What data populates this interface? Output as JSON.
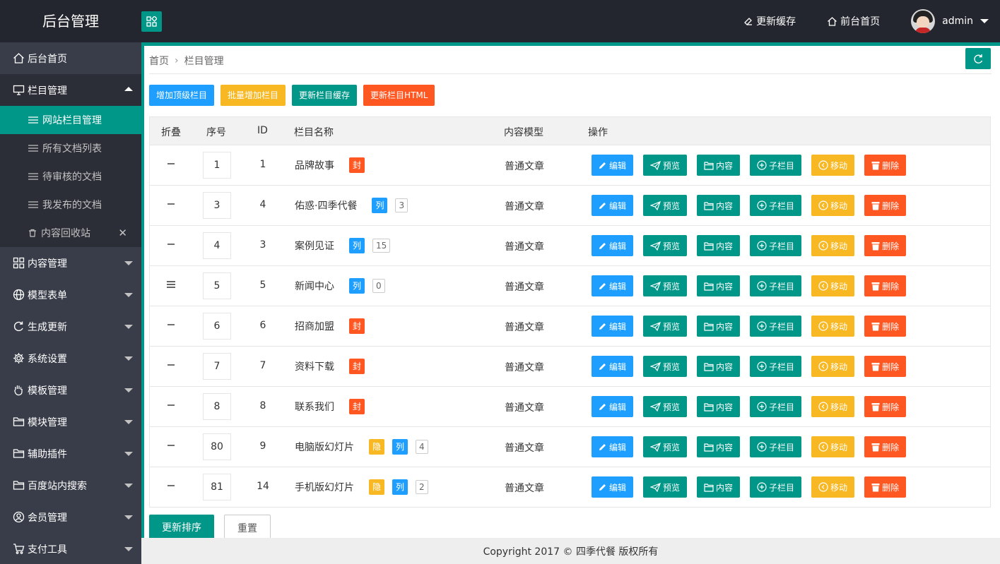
{
  "header": {
    "logo": "后台管理",
    "clear_cache": "更新缓存",
    "front_home": "前台首页",
    "user": "admin"
  },
  "sidebar": {
    "home": "后台首页",
    "column_mgmt": "栏目管理",
    "sub": [
      {
        "label": "网站栏目管理"
      },
      {
        "label": "所有文档列表"
      },
      {
        "label": "待审核的文档"
      },
      {
        "label": "我发布的文档"
      },
      {
        "label": "内容回收站"
      }
    ],
    "sections": [
      {
        "label": "内容管理",
        "icon": "apps-icon"
      },
      {
        "label": "模型表单",
        "icon": "globe-icon"
      },
      {
        "label": "生成更新",
        "icon": "refresh-icon"
      },
      {
        "label": "系统设置",
        "icon": "gear-icon"
      },
      {
        "label": "模板管理",
        "icon": "hand-icon"
      },
      {
        "label": "模块管理",
        "icon": "folder-icon"
      },
      {
        "label": "辅助插件",
        "icon": "folder-icon"
      },
      {
        "label": "百度站内搜索",
        "icon": "folder-icon"
      },
      {
        "label": "会员管理",
        "icon": "user-icon"
      },
      {
        "label": "支付工具",
        "icon": "cart-icon"
      }
    ]
  },
  "breadcrumb": {
    "home": "首页",
    "current": "栏目管理"
  },
  "actions": {
    "add_top": "增加顶级栏目",
    "batch_add": "批量增加栏目",
    "update_cache": "更新栏目缓存",
    "update_html": "更新栏目HTML"
  },
  "table": {
    "headers": {
      "fold": "折叠",
      "seq": "序号",
      "id": "ID",
      "name": "栏目名称",
      "model": "内容模型",
      "ops": "操作"
    },
    "op_labels": {
      "edit": "编辑",
      "preview": "预览",
      "content": "内容",
      "child": "子栏目",
      "move": "移动",
      "delete": "删除"
    },
    "rows": [
      {
        "fold": "—",
        "seq": "1",
        "id": "1",
        "name": "品牌故事",
        "badges": [
          {
            "text": "封",
            "color": "red"
          }
        ],
        "count": "",
        "model": "普通文章"
      },
      {
        "fold": "—",
        "seq": "3",
        "id": "4",
        "name": "佑惑·四季代餐",
        "badges": [
          {
            "text": "列",
            "color": "blue"
          }
        ],
        "count": "3",
        "model": "普通文章"
      },
      {
        "fold": "—",
        "seq": "4",
        "id": "3",
        "name": "案例见证",
        "badges": [
          {
            "text": "列",
            "color": "blue"
          }
        ],
        "count": "15",
        "model": "普通文章"
      },
      {
        "fold": "≡",
        "seq": "5",
        "id": "5",
        "name": "新闻中心",
        "badges": [
          {
            "text": "列",
            "color": "blue"
          }
        ],
        "count": "0",
        "model": "普通文章"
      },
      {
        "fold": "—",
        "seq": "6",
        "id": "6",
        "name": "招商加盟",
        "badges": [
          {
            "text": "封",
            "color": "red"
          }
        ],
        "count": "",
        "model": "普通文章"
      },
      {
        "fold": "—",
        "seq": "7",
        "id": "7",
        "name": "资料下载",
        "badges": [
          {
            "text": "封",
            "color": "red"
          }
        ],
        "count": "",
        "model": "普通文章"
      },
      {
        "fold": "—",
        "seq": "8",
        "id": "8",
        "name": "联系我们",
        "badges": [
          {
            "text": "封",
            "color": "red"
          }
        ],
        "count": "",
        "model": "普通文章"
      },
      {
        "fold": "—",
        "seq": "80",
        "id": "9",
        "name": "电脑版幻灯片",
        "badges": [
          {
            "text": "隐",
            "color": "yellow"
          },
          {
            "text": "列",
            "color": "blue"
          }
        ],
        "count": "4",
        "model": "普通文章"
      },
      {
        "fold": "—",
        "seq": "81",
        "id": "14",
        "name": "手机版幻灯片",
        "badges": [
          {
            "text": "隐",
            "color": "yellow"
          },
          {
            "text": "列",
            "color": "blue"
          }
        ],
        "count": "2",
        "model": "普通文章"
      }
    ]
  },
  "bottom": {
    "update_sort": "更新排序",
    "reset": "重置"
  },
  "footer": "Copyright 2017 © 四季代餐 版权所有",
  "colors": {
    "accent": "#009688",
    "blue": "#1e9fff",
    "yellow": "#f7b824",
    "orange": "#ff5722",
    "sidebar": "#393d49",
    "header": "#23262e"
  }
}
